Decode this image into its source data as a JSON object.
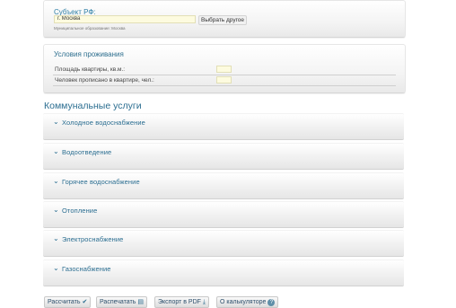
{
  "subject": {
    "label": "Субъект РФ:",
    "value": "г. Москва",
    "choose_button": "Выбрать другое",
    "municipality": "Муниципальное образование: Москва"
  },
  "living": {
    "title": "Условия проживания",
    "rows": [
      {
        "label": "Площадь квартиры, кв.м.:",
        "value": ""
      },
      {
        "label": "Человек прописано в квартире, чел.:",
        "value": ""
      }
    ]
  },
  "utilities": {
    "title": "Коммунальные услуги",
    "sections": [
      {
        "label": "Холодное водоснабжение",
        "icon": "chevron-down-icon"
      },
      {
        "label": "Водоотведение",
        "icon": "chevron-down-icon"
      },
      {
        "label": "Горячее водоснабжение",
        "icon": "chevron-down-icon"
      },
      {
        "label": "Отопление",
        "icon": "chevron-down-icon"
      },
      {
        "label": "Электроснабжение",
        "icon": "chevron-down-icon"
      },
      {
        "label": "Газоснабжение",
        "icon": "chevron-down-icon"
      }
    ]
  },
  "actions": {
    "calculate": "Рассчитать",
    "print": "Распечатать",
    "export_pdf": "Экспорт в PDF",
    "about": "О калькуляторе"
  }
}
